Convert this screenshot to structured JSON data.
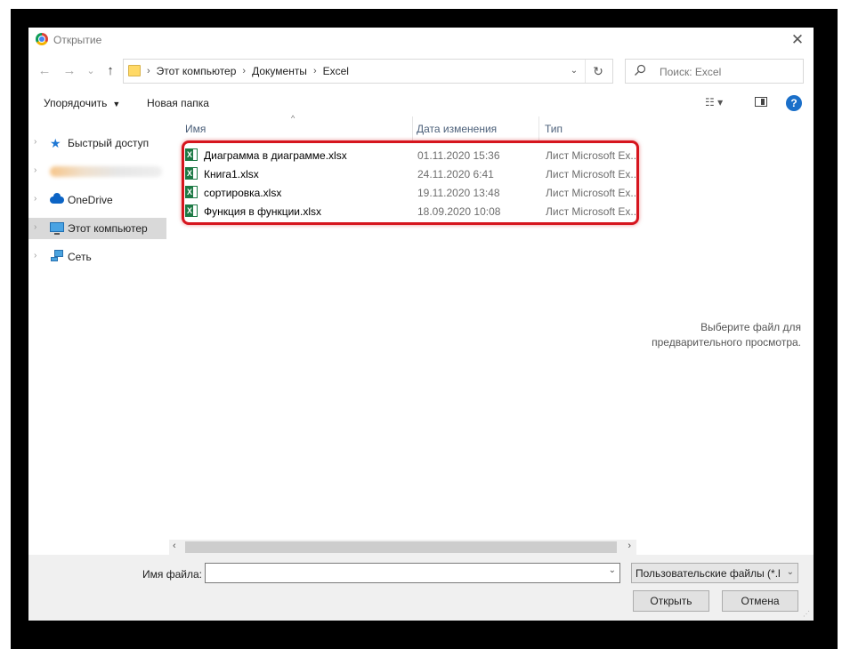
{
  "window": {
    "title": "Открытие",
    "close_glyph": "✕"
  },
  "nav": {
    "back": "←",
    "forward": "→",
    "recent": "⌄",
    "up": "↑",
    "breadcrumbs": [
      "Этот компьютер",
      "Документы",
      "Excel"
    ],
    "separator": "›",
    "dropdown": "⌄",
    "refresh": "↻",
    "search_placeholder": "Поиск: Excel"
  },
  "toolbar": {
    "organize_label": "Упорядочить",
    "organize_caret": "▼",
    "new_folder_label": "Новая папка",
    "view_glyph": "☷ ▾",
    "help_glyph": "?"
  },
  "sidebar": {
    "items": [
      {
        "label": "Быстрый доступ",
        "icon": "star-icon"
      },
      {
        "label": "",
        "icon": "blurred-item"
      },
      {
        "label": "OneDrive",
        "icon": "cloud-icon"
      },
      {
        "label": "Этот компьютер",
        "icon": "computer-icon",
        "selected": true
      },
      {
        "label": "Сеть",
        "icon": "network-icon"
      }
    ]
  },
  "columns": {
    "name": "Имя",
    "date": "Дата изменения",
    "type": "Тип",
    "sort_glyph": "^"
  },
  "files": [
    {
      "name": "Диаграмма в диаграмме.xlsx",
      "date": "01.11.2020 15:36",
      "type": "Лист Microsoft Ex..."
    },
    {
      "name": "Книга1.xlsx",
      "date": "24.11.2020 6:41",
      "type": "Лист Microsoft Ex..."
    },
    {
      "name": "сортировка.xlsx",
      "date": "19.11.2020 13:48",
      "type": "Лист Microsoft Ex..."
    },
    {
      "name": "Функция в функции.xlsx",
      "date": "18.09.2020 10:08",
      "type": "Лист Microsoft Ex..."
    }
  ],
  "preview": {
    "line1": "Выберите файл для",
    "line2": "предварительного просмотра."
  },
  "scroll": {
    "left": "‹",
    "right": "›"
  },
  "bottom": {
    "filename_label": "Имя файла:",
    "filename_value": "",
    "filetype_value": "Пользовательские файлы (*.h",
    "open_label": "Открыть",
    "cancel_label": "Отмена"
  },
  "colors": {
    "highlight": "#d6151e",
    "accent": "#1a6fc9"
  }
}
